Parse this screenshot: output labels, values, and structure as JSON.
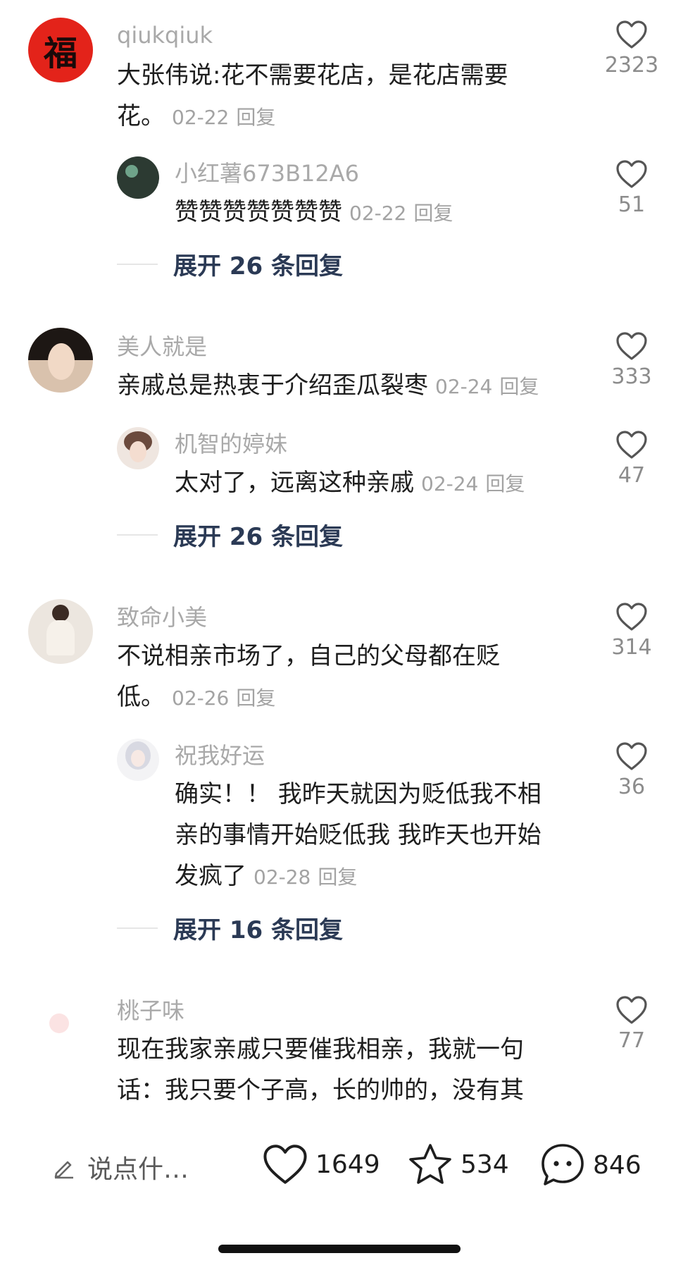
{
  "comments": [
    {
      "username": "qiukqiuk",
      "text": "大张伟说:花不需要花店，是花店需要",
      "text2": "花。",
      "date": "02-22",
      "reply_label": "回复",
      "likes": "2323",
      "avatar_glyph": "福",
      "reply": {
        "username": "小红薯673B12A6",
        "text": "赞赞赞赞赞赞赞",
        "date": "02-22",
        "reply_label": "回复",
        "likes": "51"
      },
      "expand": "展开 26 条回复"
    },
    {
      "username": "美人就是",
      "text": "亲戚总是热衷于介绍歪瓜裂枣",
      "date": "02-24",
      "reply_label": "回复",
      "likes": "333",
      "reply": {
        "username": "机智的婷妹",
        "text": "太对了，远离这种亲戚",
        "date": "02-24",
        "reply_label": "回复",
        "likes": "47"
      },
      "expand": "展开 26 条回复"
    },
    {
      "username": "致命小美",
      "text": "不说相亲市场了，自己的父母都在贬",
      "text2": "低。",
      "date": "02-26",
      "reply_label": "回复",
      "likes": "314",
      "reply": {
        "username": "祝我好运",
        "text": "确实！！ 我昨天就因为贬低我不相",
        "text2": "亲的事情开始贬低我 我昨天也开始",
        "text3": "发疯了",
        "date": "02-28",
        "reply_label": "回复",
        "likes": "36"
      },
      "expand": "展开 16 条回复"
    },
    {
      "username": "桃子味",
      "text": "现在我家亲戚只要催我相亲，我就一句",
      "text2": "话：我只要个子高，长的帅的，没有其",
      "likes": "77"
    }
  ],
  "bottom_bar": {
    "compose_placeholder": "说点什…",
    "likes": "1649",
    "favorites": "534",
    "comments": "846"
  },
  "colors": {
    "username": "#a9a9a9",
    "meta": "#a3a3a3",
    "expand": "#2b3a55",
    "avatar_red": "#e3231a"
  },
  "icons": [
    "heart-icon",
    "star-icon",
    "chat-bubble-icon",
    "pencil-icon"
  ]
}
